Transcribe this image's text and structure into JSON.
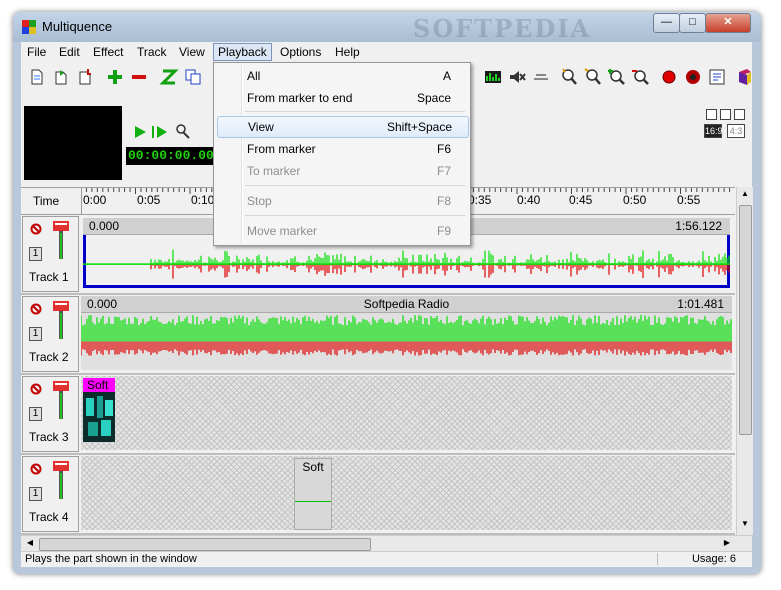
{
  "window": {
    "title": "Multiquence",
    "watermark": "SOFTPEDIA",
    "controls": {
      "minimize": "—",
      "maximize": "□",
      "close": "✕"
    }
  },
  "menu": [
    "File",
    "Edit",
    "Effect",
    "Track",
    "View",
    "Playback",
    "Options",
    "Help"
  ],
  "playback_menu": [
    {
      "label": "All",
      "shortcut": "A",
      "enabled": true,
      "highlighted": false
    },
    {
      "label": "From marker to end",
      "shortcut": "Space",
      "enabled": true,
      "highlighted": false
    },
    {
      "label": "View",
      "shortcut": "Shift+Space",
      "enabled": true,
      "highlighted": true
    },
    {
      "label": "From marker",
      "shortcut": "F6",
      "enabled": true,
      "highlighted": false
    },
    {
      "label": "To marker",
      "shortcut": "F7",
      "enabled": false,
      "highlighted": false
    },
    {
      "label": "Stop",
      "shortcut": "F8",
      "enabled": false,
      "highlighted": false
    },
    {
      "label": "Move marker",
      "shortcut": "F9",
      "enabled": false,
      "highlighted": false
    }
  ],
  "timecode": "00:00:00.000",
  "aspect": {
    "wide": "16:9",
    "standard": "4:3"
  },
  "timeline": {
    "label": "Time",
    "ticks": [
      "0:00",
      "0:05",
      "0:10",
      "0:35",
      "0:40",
      "0:45",
      "0:50",
      "0:55"
    ]
  },
  "tracks": [
    {
      "name": "Track 1",
      "number": "1",
      "start": "0.000",
      "title": "",
      "length": "1:56.122",
      "type": "audio",
      "selected": true
    },
    {
      "name": "Track 2",
      "number": "1",
      "start": "0.000",
      "title": "Softpedia Radio",
      "length": "1:01.481",
      "type": "audio",
      "selected": false
    },
    {
      "name": "Track 3",
      "number": "1",
      "clip_label": "Soft",
      "type": "video",
      "selected": false
    },
    {
      "name": "Track 4",
      "number": "1",
      "clip_label": "Soft",
      "type": "empty-clip",
      "selected": false
    }
  ],
  "status": {
    "text": "Plays the part shown in the window",
    "usage": "Usage: 6"
  },
  "colors": {
    "wave_green": "#00e000",
    "wave_red": "#e00000",
    "timecode": "#1fd40b",
    "selection": "#0000c8",
    "clip_magenta": "#ff00ff"
  }
}
